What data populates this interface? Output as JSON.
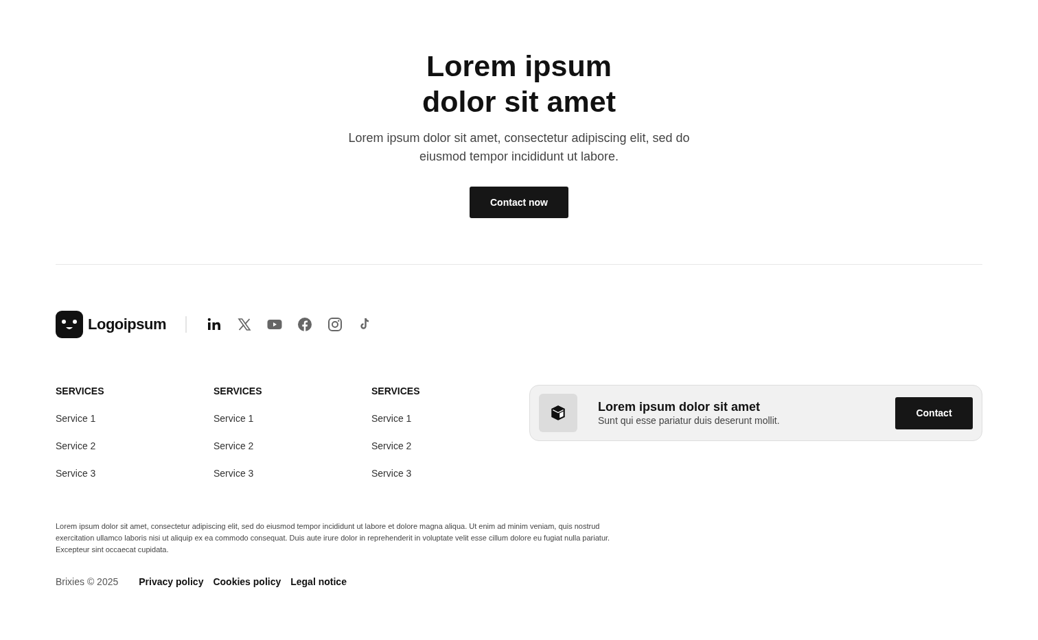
{
  "hero": {
    "title_lines": [
      "Lorem ipsum",
      "dolor sit amet"
    ],
    "subtitle": "Lorem ipsum dolor sit amet, consectetur adipiscing elit, sed do eiusmod tempor incididunt ut labore.",
    "button": "Contact now"
  },
  "footer": {
    "logo": "Logoipsum",
    "columns": [
      {
        "heading": "SERVICES",
        "links": [
          "Service 1",
          "Service 2",
          "Service 3"
        ]
      },
      {
        "heading": "SERVICES",
        "links": [
          "Service 1",
          "Service 2",
          "Service 3"
        ]
      },
      {
        "heading": "SERVICES",
        "links": [
          "Service 1",
          "Service 2",
          "Service 3"
        ]
      }
    ],
    "cta": {
      "title": "Lorem ipsum dolor sit amet",
      "text": "Sunt qui esse pariatur duis deserunt mollit.",
      "button": "Contact"
    },
    "legal_text": "Lorem ipsum dolor sit amet, consectetur adipiscing elit, sed do eiusmod tempor incididunt ut labore et dolore magna aliqua. Ut enim ad minim veniam, quis nostrud exercitation ullamco laboris nisi ut aliquip ex ea commodo consequat. Duis aute irure dolor in reprehenderit in voluptate velit esse cillum dolore eu fugiat nulla pariatur. Excepteur sint occaecat cupidata.",
    "copyright": "Brixies © 2025",
    "links": [
      "Privacy policy",
      "Cookies policy",
      "Legal notice"
    ]
  }
}
